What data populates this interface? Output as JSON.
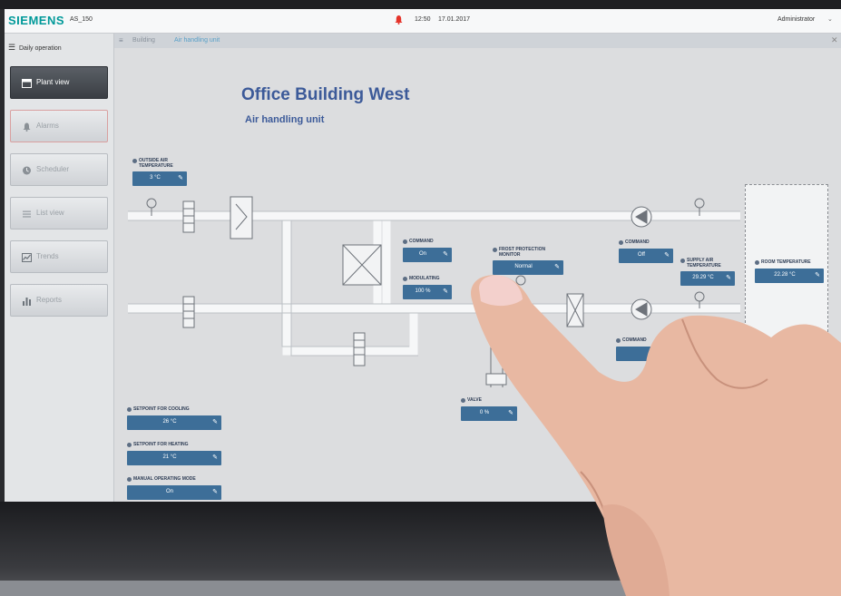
{
  "topbar": {
    "brand": "SIEMENS",
    "station": "AS_150",
    "time": "12:50",
    "date": "17.01.2017",
    "user": "Administrator",
    "alarm_color": "#e5332a"
  },
  "sidebar": {
    "title": "Daily operation",
    "items": [
      {
        "label": "Plant view",
        "icon": "plant-view-icon",
        "active": true
      },
      {
        "label": "Alarms",
        "icon": "bell-icon"
      },
      {
        "label": "Scheduler",
        "icon": "clock-icon"
      },
      {
        "label": "List view",
        "icon": "list-icon"
      },
      {
        "label": "Trends",
        "icon": "trend-icon"
      },
      {
        "label": "Reports",
        "icon": "bar-chart-icon"
      }
    ]
  },
  "breadcrumb": {
    "building": "Building",
    "current": "Air handling unit"
  },
  "page": {
    "title": "Office Building West",
    "subtitle": "Air handling unit"
  },
  "datapoints": {
    "outside_air": {
      "label": "Outside air temperature",
      "value": "3 °C"
    },
    "command_1": {
      "label": "Command",
      "value": "On"
    },
    "modulating": {
      "label": "Modulating",
      "value": "100 %"
    },
    "frost": {
      "label": "Frost protection monitor",
      "value": "Normal"
    },
    "command_2": {
      "label": "Command",
      "value": "Off"
    },
    "supply_air": {
      "label": "Supply air temperature",
      "value": "29.29 °C"
    },
    "room_temp": {
      "label": "Room temperature",
      "value": "22.28 °C"
    },
    "command_3": {
      "label": "Command"
    },
    "valve": {
      "label": "Valve",
      "value": "0 %"
    },
    "cooling": {
      "label": "Setpoint for cooling",
      "value": "26 °C"
    },
    "heating": {
      "label": "Setpoint for heating",
      "value": "21 °C"
    },
    "mode": {
      "label": "Manual operating mode",
      "value": "On"
    }
  },
  "accent": {
    "brand": "#009999",
    "title": "#3c5a99",
    "box": "#3d6e98"
  }
}
